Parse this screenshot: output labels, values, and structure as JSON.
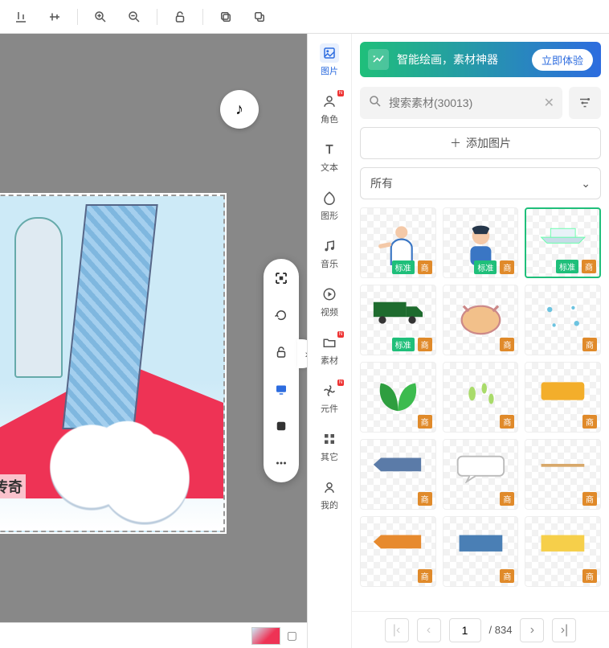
{
  "toolbar": {
    "icons": [
      "align-bottom",
      "align-middle",
      "zoom-in",
      "zoom-out",
      "unlock",
      "copy",
      "paste"
    ]
  },
  "canvas": {
    "caption": "写传奇",
    "music_glyph": "♪"
  },
  "float_tools": [
    "focus",
    "rotate",
    "unlock",
    "display",
    "info",
    "more"
  ],
  "nav": {
    "items": [
      {
        "key": "image",
        "label": "图片",
        "icon": "img",
        "active": true
      },
      {
        "key": "role",
        "label": "角色",
        "icon": "person",
        "dot": true
      },
      {
        "key": "text",
        "label": "文本",
        "icon": "T"
      },
      {
        "key": "shape",
        "label": "图形",
        "icon": "shape"
      },
      {
        "key": "music",
        "label": "音乐",
        "icon": "note"
      },
      {
        "key": "video",
        "label": "视频",
        "icon": "play"
      },
      {
        "key": "asset",
        "label": "素材",
        "icon": "folder",
        "dot": true
      },
      {
        "key": "component",
        "label": "元件",
        "icon": "fan",
        "dot": true
      },
      {
        "key": "other",
        "label": "其它",
        "icon": "grid"
      },
      {
        "key": "mine",
        "label": "我的",
        "icon": "user"
      }
    ]
  },
  "promo": {
    "text": "智能绘画，素材神器",
    "cta": "立即体验"
  },
  "search": {
    "placeholder": "搜索素材(30013)",
    "icon": "search"
  },
  "add_button": "添加图片",
  "category": {
    "selected": "所有"
  },
  "tiles": [
    {
      "id": 1,
      "kind": "doctor",
      "badges": [
        "商",
        "标准"
      ]
    },
    {
      "id": 2,
      "kind": "boy",
      "badges": [
        "商",
        "标准"
      ]
    },
    {
      "id": 3,
      "kind": "ship",
      "badges": [
        "商",
        "标准"
      ],
      "selected": true
    },
    {
      "id": 4,
      "kind": "truck",
      "badges": [
        "商",
        "标准"
      ]
    },
    {
      "id": 5,
      "kind": "chicken",
      "badges": [
        "商"
      ]
    },
    {
      "id": 6,
      "kind": "dots",
      "badges": [
        "商"
      ]
    },
    {
      "id": 7,
      "kind": "leaf",
      "badges": [
        "商"
      ]
    },
    {
      "id": 8,
      "kind": "sprout",
      "badges": [
        "商"
      ]
    },
    {
      "id": 9,
      "kind": "rect-yellow",
      "badges": [
        "商"
      ]
    },
    {
      "id": 10,
      "kind": "arrow-blue",
      "badges": [
        "商"
      ]
    },
    {
      "id": 11,
      "kind": "speech",
      "badges": [
        "商"
      ]
    },
    {
      "id": 12,
      "kind": "rect-line",
      "badges": [
        "商"
      ]
    },
    {
      "id": 13,
      "kind": "arrow-orange",
      "badges": [
        "商"
      ]
    },
    {
      "id": 14,
      "kind": "rect-blue",
      "badges": [
        "商"
      ]
    },
    {
      "id": 15,
      "kind": "rect-gold",
      "badges": [
        "商"
      ]
    }
  ],
  "badges_map": {
    "商": "com",
    "标准": "std"
  },
  "pager": {
    "page": "1",
    "total": "834",
    "sep": "/ "
  },
  "colors": {
    "accent": "#2d6cdf",
    "green": "#1fbf7a",
    "orange": "#e08a2a"
  }
}
